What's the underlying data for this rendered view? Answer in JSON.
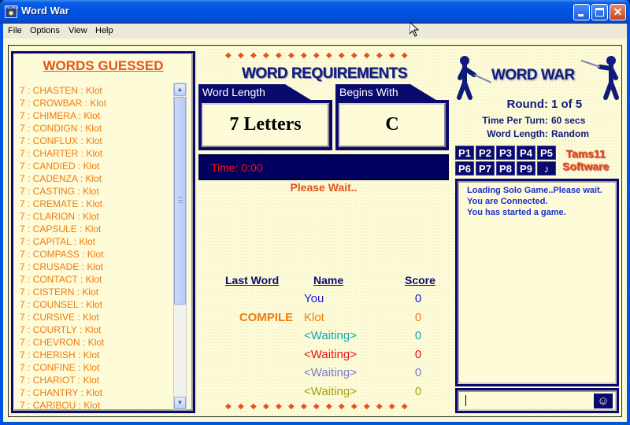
{
  "window": {
    "title": "Word War",
    "icon": "word-war-app-icon",
    "controls": [
      "minimize",
      "maximize",
      "close"
    ]
  },
  "menu": {
    "items": [
      {
        "label": "File",
        "accel": "F"
      },
      {
        "label": "Options",
        "accel": "O"
      },
      {
        "label": "View",
        "accel": "V"
      },
      {
        "label": "Help",
        "accel": "H"
      }
    ]
  },
  "words_guessed": {
    "title": "WORDS GUESSED",
    "items": [
      "7 : CHASTEN : Klot",
      "7 : CROWBAR : Klot",
      "7 : CHIMERA : Klot",
      "7 : CONDIGN : Klot",
      "7 : CONFLUX : Klot",
      "7 : CHARTER : Klot",
      "7 : CANDIED : Klot",
      "7 : CADENZA : Klot",
      "7 : CASTING : Klot",
      "7 : CREMATE : Klot",
      "7 : CLARION : Klot",
      "7 : CAPSULE : Klot",
      "7 : CAPITAL : Klot",
      "7 : COMPASS : Klot",
      "7 : CRUSADE : Klot",
      "7 : CONTACT : Klot",
      "7 : CISTERN : Klot",
      "7 : COUNSEL : Klot",
      "7 : CURSIVE : Klot",
      "7 : COURTLY : Klot",
      "7 : CHEVRON : Klot",
      "7 : CHERISH : Klot",
      "7 : CONFINE : Klot",
      "7 : CHARIOT : Klot",
      "7 : CHANTRY : Klot",
      "7 : CARIBOU : Klot"
    ]
  },
  "requirements": {
    "title": "WORD REQUIREMENTS",
    "word_length_label": "Word Length",
    "word_length_value": "7 Letters",
    "begins_with_label": "Begins With",
    "begins_with_value": "C"
  },
  "timer": {
    "text": "Time: 0:00"
  },
  "status": {
    "text": "Please Wait.."
  },
  "scoreboard": {
    "headers": {
      "last_word": "Last Word",
      "name": "Name",
      "score": "Score"
    },
    "rows": [
      {
        "last_word": "",
        "name": "You",
        "score": "0",
        "color": "#1a1ad0"
      },
      {
        "last_word": "COMPILE",
        "name": "Klot",
        "score": "0",
        "color": "#f07a10"
      },
      {
        "last_word": "",
        "name": "<Waiting>",
        "score": "0",
        "color": "#10a8b0"
      },
      {
        "last_word": "",
        "name": "<Waiting>",
        "score": "0",
        "color": "#f01010"
      },
      {
        "last_word": "",
        "name": "<Waiting>",
        "score": "0",
        "color": "#7a7ad0"
      },
      {
        "last_word": "",
        "name": "<Waiting>",
        "score": "0",
        "color": "#a8a010"
      }
    ]
  },
  "logo": {
    "text": "WORD WAR"
  },
  "game_info": {
    "round_label": "Round:",
    "round_value": "1 of 5",
    "time_label": "Time Per Turn:",
    "time_value": "60 secs",
    "length_label": "Word Length:",
    "length_value": "Random"
  },
  "player_buttons": [
    "P1",
    "P2",
    "P3",
    "P4",
    "P5",
    "P6",
    "P7",
    "P8",
    "P9",
    "♪"
  ],
  "brand": {
    "line1": "Tams11",
    "line2": "Software"
  },
  "chat": {
    "lines": [
      "Loading Solo Game..Please wait.",
      "You are Connected.",
      "You has started a game."
    ],
    "input_value": "",
    "emoticon_icon": "smiley-icon"
  },
  "colors": {
    "navy": "#0a0a6e",
    "accent_orange": "#e5531c",
    "word_orange": "#f07a10",
    "panel_bg": "#fdfbd8",
    "timer_red": "#ff1010",
    "chat_blue": "#1a2fd0"
  }
}
